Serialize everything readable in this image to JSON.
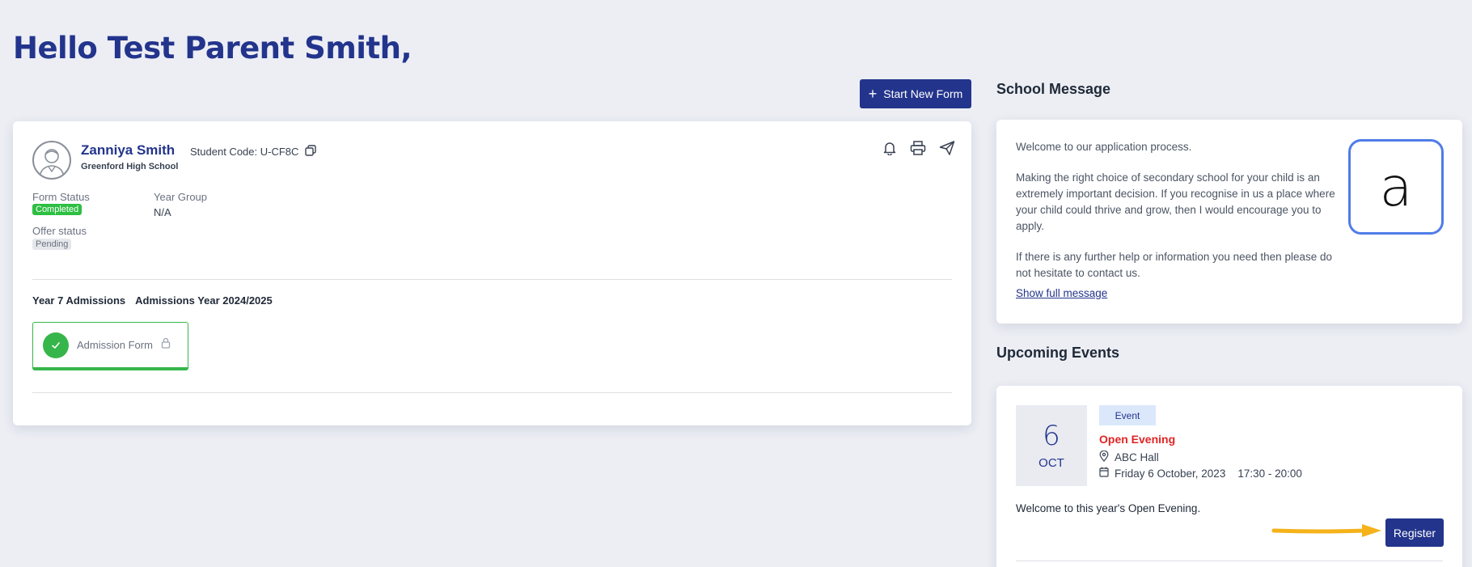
{
  "header": {
    "greeting": "Hello Test Parent Smith,"
  },
  "toolbar": {
    "start_new_form_label": "Start New Form"
  },
  "student": {
    "name": "Zanniya Smith",
    "code_label": "Student Code: U-CF8C",
    "school": "Greenford High School",
    "form_status_label": "Form Status",
    "form_status_value": "Completed",
    "year_group_label": "Year Group",
    "year_group_value": "N/A",
    "offer_status_label": "Offer status",
    "offer_status_value": "Pending",
    "admission_title": "Year 7 Admissions",
    "admission_year": "Admissions Year 2024/2025",
    "form_tile_label": "Admission Form"
  },
  "school_message": {
    "title": "School Message",
    "paragraphs": [
      "Welcome to our application process.",
      "Making the right choice of secondary school for your child is an extremely important decision.  If you recognise in us a place where your child could thrive and grow, then I would encourage you to apply.",
      "If there is any further help or information you need then please do not hesitate to contact us."
    ],
    "show_full_label": "Show full message",
    "logo_letter": "a"
  },
  "events": {
    "title": "Upcoming Events",
    "items": [
      {
        "day": "6",
        "month": "OCT",
        "tag": "Event",
        "name": "Open Evening",
        "location": "ABC Hall",
        "date": "Friday 6 October, 2023",
        "time": "17:30 - 20:00",
        "description": "Welcome to this year's Open Evening.",
        "register_label": "Register"
      }
    ]
  },
  "colors": {
    "brand": "#23348c",
    "success": "#36b64a",
    "event_title": "#e02424",
    "annotation_arrow": "#f5b21b"
  },
  "icons": {
    "start_form": "plus-icon",
    "copy_code": "copy-icon",
    "actions": [
      "bell-icon",
      "printer-icon",
      "send-icon"
    ],
    "form_tile_status": "check-icon",
    "form_tile_lock": "lock-icon",
    "location": "map-pin-icon",
    "date": "calendar-icon"
  }
}
